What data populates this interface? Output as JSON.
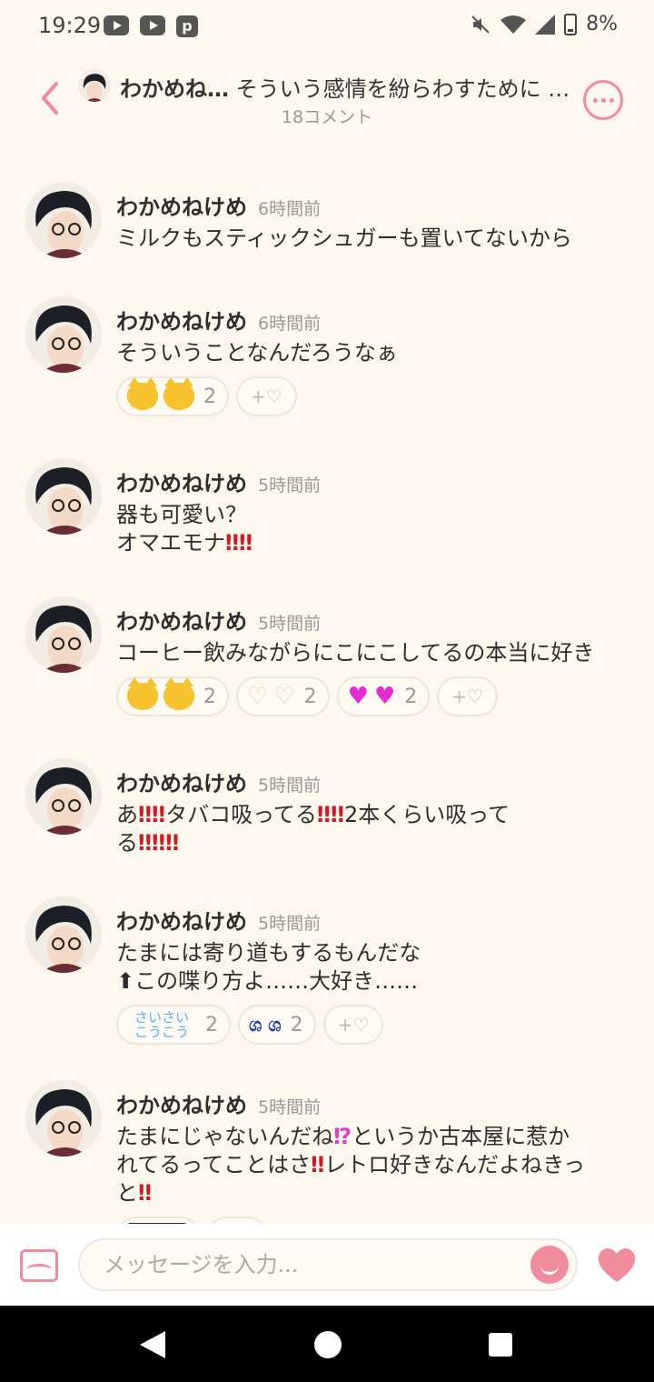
{
  "status_bar": {
    "time": "19:29",
    "battery": "8%"
  },
  "header": {
    "author": "わかめね…",
    "title": "そういう感情を紛らわすために …",
    "comment_count": "18コメント"
  },
  "comments": [
    {
      "name": "わかめねけめ",
      "time": "6時間前",
      "text": "ミルクもスティックシュガーも置いてないから"
    },
    {
      "name": "わかめねけめ",
      "time": "6時間前",
      "text": "そういうことなんだろうなぁ",
      "reactions": [
        {
          "emoji": "cat",
          "count": "2"
        }
      ]
    },
    {
      "name": "わかめねけめ",
      "time": "5時間前",
      "line1": "器も可愛い？",
      "line2": "オマエモナ"
    },
    {
      "name": "わかめねけめ",
      "time": "5時間前",
      "text": "コーヒー飲みながらにこにこしてるの本当に好き",
      "reactions": [
        {
          "emoji": "cat",
          "count": "2"
        },
        {
          "emoji": "heart-hands",
          "count": "2"
        },
        {
          "emoji": "sparkle-hearts",
          "count": "2"
        }
      ]
    },
    {
      "name": "わかめねけめ",
      "time": "5時間前",
      "seg1": "あ",
      "seg2": "タバコ吸ってる",
      "seg3": "2本くらい吸って",
      "seg4": "る"
    },
    {
      "name": "わかめねけめ",
      "time": "5時間前",
      "line1": "たまには寄り道もするもんだな",
      "line2": "⬆この喋り方よ……大好き……",
      "reactions": [
        {
          "emoji": "saisai",
          "label": "さいさい こうこう",
          "count": "2"
        },
        {
          "emoji": "tears",
          "count": "2"
        }
      ]
    },
    {
      "name": "わかめねけめ",
      "time": "5時間前",
      "seg1": "たまにじゃないんだね",
      "seg2": "というか古本屋に惹か",
      "seg3": "れてるってことはさ",
      "seg4": "レトロ好きなんだよねきっ",
      "seg5": "と"
    }
  ],
  "add_reaction_label": "+♡",
  "composer": {
    "placeholder": "メッセージを入力..."
  },
  "colors": {
    "accent": "#f08c9c",
    "background": "#fdf8ee",
    "exclaim": "#d21a24"
  }
}
